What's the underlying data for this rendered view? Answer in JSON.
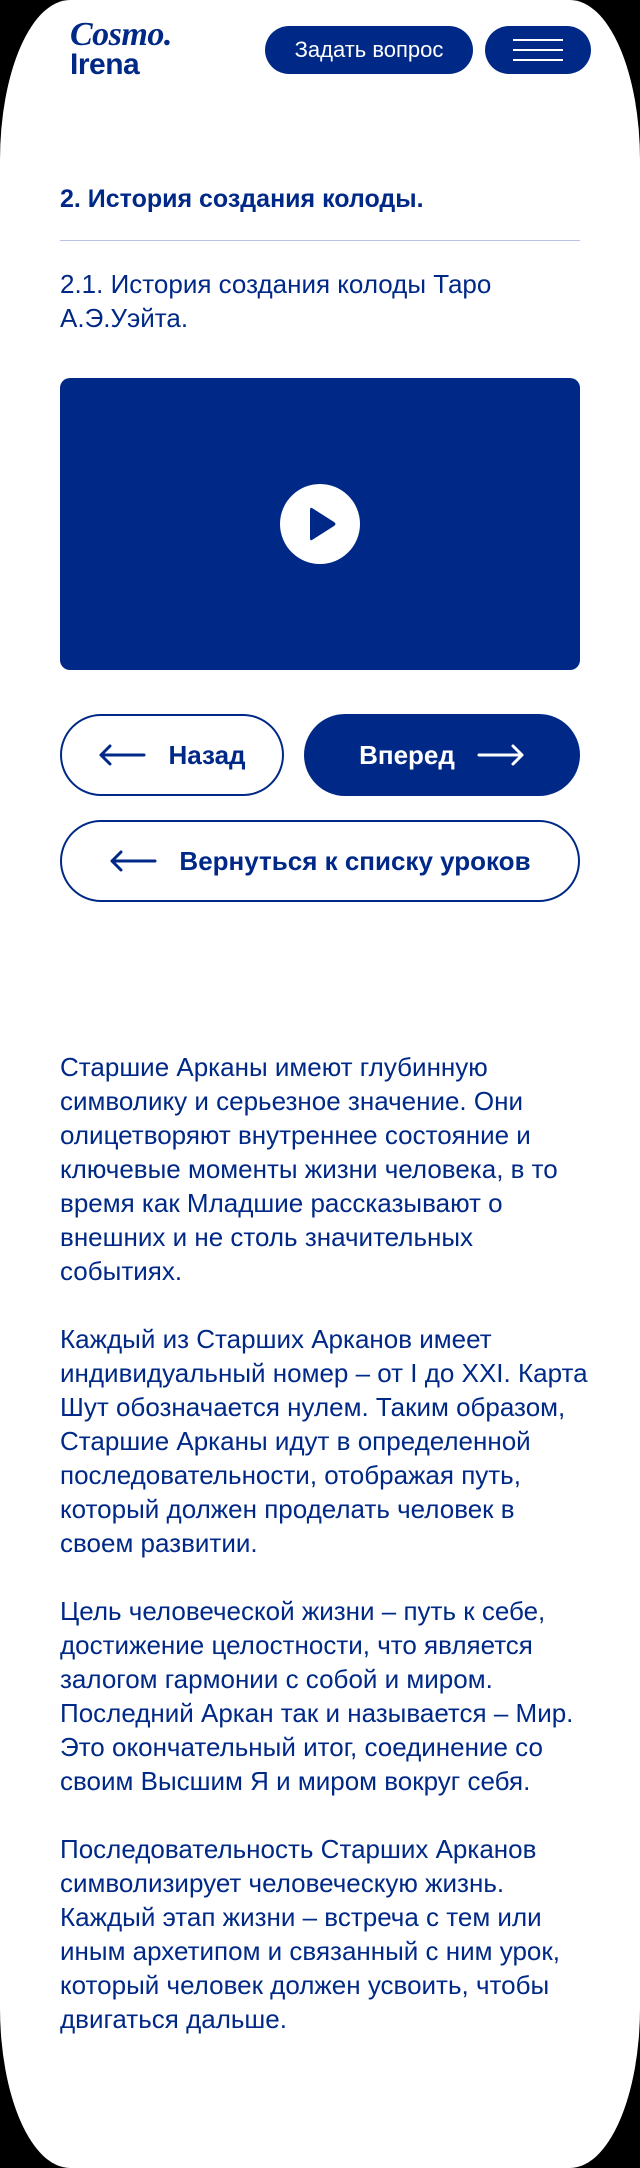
{
  "header": {
    "logo_line1": "Cosmo.",
    "logo_line2": "Irena",
    "ask_button": "Задать вопрос",
    "menu_icon": "hamburger-icon"
  },
  "lesson": {
    "section_title": "2.  История создания колоды.",
    "subsection_title": "2.1. История создания колоды Таро А.Э.Уэйта."
  },
  "video": {
    "play_icon": "play-icon",
    "accent_color": "#002987"
  },
  "navigation": {
    "back_label": "Назад",
    "next_label": "Вперед",
    "list_label": "Вернуться к списку уроков"
  },
  "content": {
    "paragraphs": [
      "Старшие Арканы имеют глубинную символику и серьезное значение. Они олицетворяют внутреннее состояние и ключевые моменты жизни человека, в то время как Младшие рассказывают о внешних и не столь значительных событиях.",
      "Каждый из Старших Арканов имеет индивидуальный номер – от I до XXI. Карта Шут обозначается нулем. Таким образом, Старшие Арканы идут в определенной последовательности, отображая путь, который должен проделать человек в своем развитии.",
      "Цель человеческой жизни – путь к себе, достижение целостности, что является залогом гармонии с собой и миром. Последний Аркан так и называется – Мир. Это окончательный итог, соединение со своим Высшим Я и миром вокруг себя.",
      "Последовательность Старших Арканов символизирует человеческую жизнь.",
      "Каждый этап жизни – встреча с тем или иным архетипом и связанный с ним урок, который человек должен усвоить, чтобы двигаться дальше."
    ]
  }
}
